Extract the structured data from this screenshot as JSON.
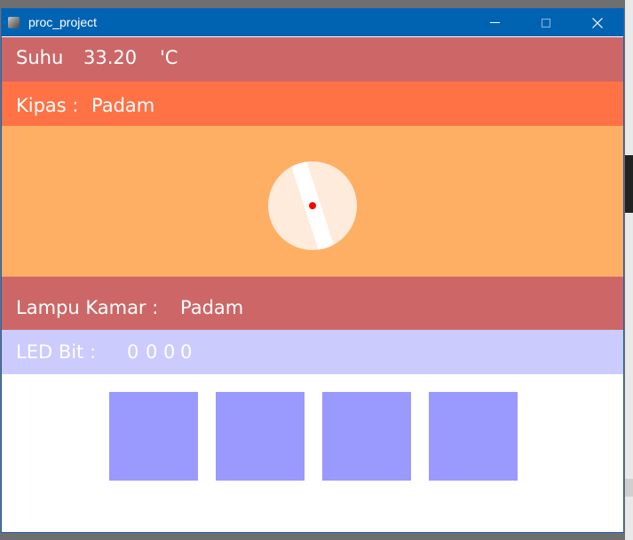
{
  "window": {
    "title": "proc_project"
  },
  "suhu": {
    "label": "Suhu",
    "value": "33.20",
    "unit": "'C"
  },
  "kipas": {
    "label": "Kipas :",
    "state": "Padam"
  },
  "lampu": {
    "label": "Lampu Kamar :",
    "state": "Padam"
  },
  "led": {
    "label": "LED Bit :",
    "bits": [
      "0",
      "0",
      "0",
      "0"
    ]
  },
  "colors": {
    "titlebar": "#0063b1",
    "suhu_bg": "#cd6767",
    "kipas_bg": "#fe7246",
    "fan_area_bg": "#ffaf64",
    "led_bar_bg": "#cbcbfe",
    "led_square": "#9999fe",
    "fan_disc": "#ffebdc",
    "fan_center": "#ff0000"
  }
}
